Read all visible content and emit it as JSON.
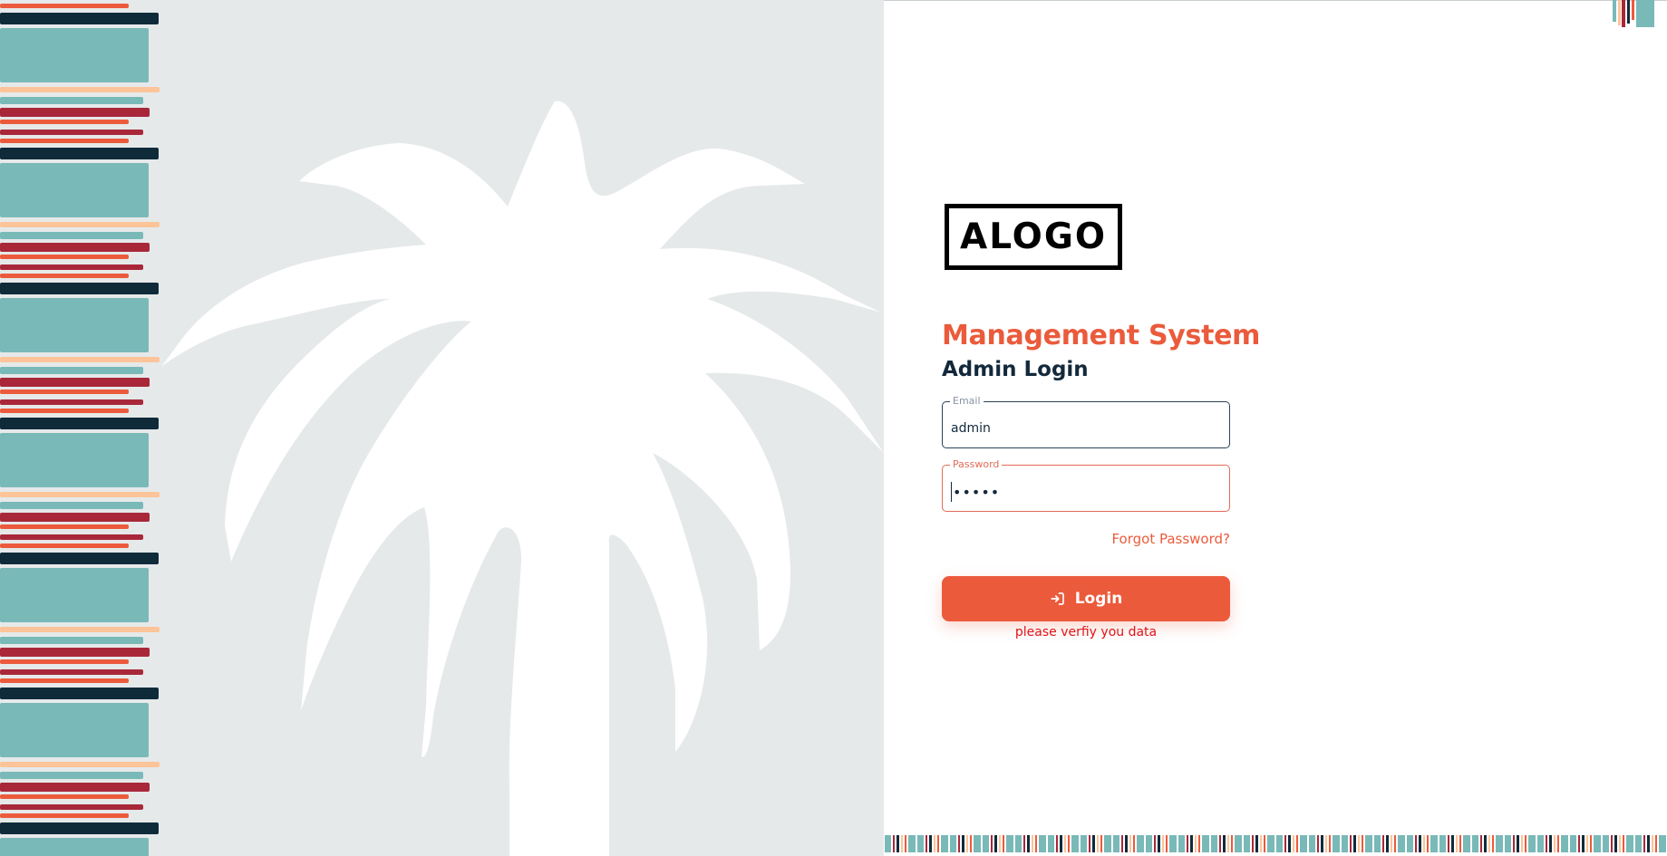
{
  "brand": {
    "logo_text": "ALOGO"
  },
  "login": {
    "title": "Management System",
    "subtitle": "Admin Login",
    "email_label": "Email",
    "email_value": "admin",
    "password_label": "Password",
    "password_value": "•••••",
    "forgot_label": "Forgot Password?",
    "submit_label": "Login",
    "error_message": "please verfiy you data"
  },
  "colors": {
    "accent": "#ec5a3c",
    "dark": "#13293b",
    "error": "#e0141a",
    "art_background": "#e6e9ea",
    "stripe_teal": "#79b9b8",
    "stripe_red": "#a8283a",
    "stripe_navy": "#0f2b3a",
    "stripe_peach": "#fcc498"
  },
  "icons": {
    "login": "login-icon",
    "palm": "palm-tree-illustration"
  }
}
